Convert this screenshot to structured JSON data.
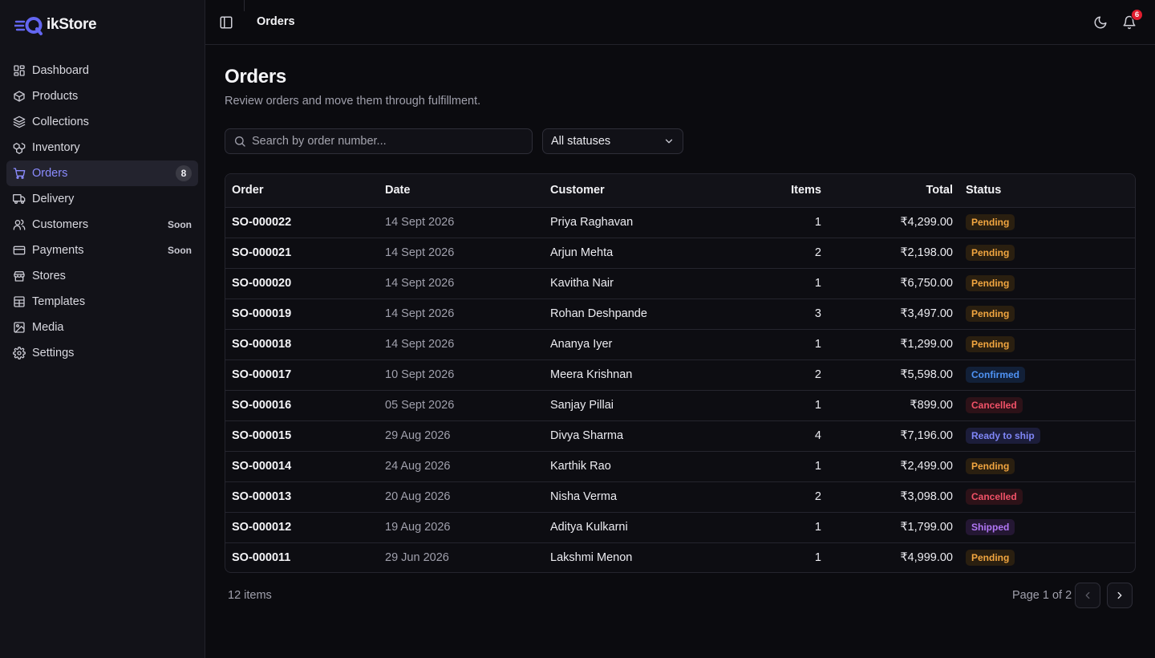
{
  "brand": {
    "name_suffix": "ikStore",
    "accent": "#6366f1"
  },
  "sidebar": {
    "items": [
      {
        "label": "Dashboard",
        "icon": "dashboard-icon"
      },
      {
        "label": "Products",
        "icon": "box-icon"
      },
      {
        "label": "Collections",
        "icon": "layers-icon"
      },
      {
        "label": "Inventory",
        "icon": "boxes-icon"
      },
      {
        "label": "Orders",
        "icon": "cart-icon",
        "count": "8",
        "active": true
      },
      {
        "label": "Delivery",
        "icon": "truck-icon"
      },
      {
        "label": "Customers",
        "icon": "users-icon",
        "tag": "Soon"
      },
      {
        "label": "Payments",
        "icon": "card-icon",
        "tag": "Soon"
      },
      {
        "label": "Stores",
        "icon": "store-icon"
      },
      {
        "label": "Templates",
        "icon": "template-icon"
      },
      {
        "label": "Media",
        "icon": "image-icon"
      },
      {
        "label": "Settings",
        "icon": "gear-icon"
      }
    ]
  },
  "topbar": {
    "breadcrumb": "Orders",
    "notification_count": "6"
  },
  "page": {
    "title": "Orders",
    "subtitle": "Review orders and move them through fulfillment."
  },
  "filters": {
    "search_placeholder": "Search by order number...",
    "status_selected": "All statuses"
  },
  "table": {
    "headers": {
      "order": "Order",
      "date": "Date",
      "customer": "Customer",
      "items": "Items",
      "total": "Total",
      "status": "Status"
    },
    "rows": [
      {
        "order": "SO-000022",
        "date": "14 Sept 2026",
        "customer": "Priya Raghavan",
        "items": "1",
        "total": "₹4,299.00",
        "status": "Pending"
      },
      {
        "order": "SO-000021",
        "date": "14 Sept 2026",
        "customer": "Arjun Mehta",
        "items": "2",
        "total": "₹2,198.00",
        "status": "Pending"
      },
      {
        "order": "SO-000020",
        "date": "14 Sept 2026",
        "customer": "Kavitha Nair",
        "items": "1",
        "total": "₹6,750.00",
        "status": "Pending"
      },
      {
        "order": "SO-000019",
        "date": "14 Sept 2026",
        "customer": "Rohan Deshpande",
        "items": "3",
        "total": "₹3,497.00",
        "status": "Pending"
      },
      {
        "order": "SO-000018",
        "date": "14 Sept 2026",
        "customer": "Ananya Iyer",
        "items": "1",
        "total": "₹1,299.00",
        "status": "Pending"
      },
      {
        "order": "SO-000017",
        "date": "10 Sept 2026",
        "customer": "Meera Krishnan",
        "items": "2",
        "total": "₹5,598.00",
        "status": "Confirmed"
      },
      {
        "order": "SO-000016",
        "date": "05 Sept 2026",
        "customer": "Sanjay Pillai",
        "items": "1",
        "total": "₹899.00",
        "status": "Cancelled"
      },
      {
        "order": "SO-000015",
        "date": "29 Aug 2026",
        "customer": "Divya Sharma",
        "items": "4",
        "total": "₹7,196.00",
        "status": "Ready to ship"
      },
      {
        "order": "SO-000014",
        "date": "24 Aug 2026",
        "customer": "Karthik Rao",
        "items": "1",
        "total": "₹2,499.00",
        "status": "Pending"
      },
      {
        "order": "SO-000013",
        "date": "20 Aug 2026",
        "customer": "Nisha Verma",
        "items": "2",
        "total": "₹3,098.00",
        "status": "Cancelled"
      },
      {
        "order": "SO-000012",
        "date": "19 Aug 2026",
        "customer": "Aditya Kulkarni",
        "items": "1",
        "total": "₹1,799.00",
        "status": "Shipped"
      },
      {
        "order": "SO-000011",
        "date": "29 Jun 2026",
        "customer": "Lakshmi Menon",
        "items": "1",
        "total": "₹4,999.00",
        "status": "Pending"
      }
    ]
  },
  "footer": {
    "items_count": "12 items",
    "page_info": "Page 1 of 2"
  },
  "status_colors": {
    "Pending": "#f2a640",
    "Confirmed": "#4f93f5",
    "Cancelled": "#f25268",
    "Ready to ship": "#7f86f7",
    "Shipped": "#b176f5"
  }
}
